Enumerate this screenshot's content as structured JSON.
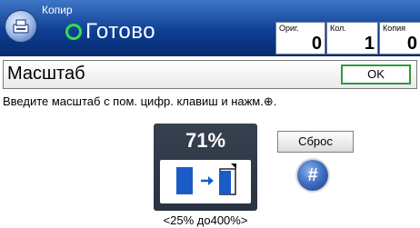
{
  "header": {
    "app_title": "Копир",
    "status": "Готово",
    "counters": [
      {
        "label": "Ориг.",
        "value": "0"
      },
      {
        "label": "Кол.",
        "value": "1"
      },
      {
        "label": "Копия",
        "value": "0"
      }
    ]
  },
  "dialog": {
    "title": "Масштаб",
    "ok_label": "OK",
    "instruction": "Введите масштаб с пом. цифр. клавиш и нажм.⊕.",
    "scale_value": "71%",
    "range": "<25% до400%>",
    "reset_label": "Сброс",
    "hash_label": "#"
  },
  "colors": {
    "header_top": "#3f76c6",
    "header_bottom": "#062a6e",
    "status_ready": "#32e04a",
    "ok_border": "#2e9b3a",
    "scale_panel": "#2f3846",
    "doc_blue": "#1a5bc8"
  },
  "icons": {
    "app": "copier-icon",
    "status": "ready-ring-icon",
    "scale": "reduce-document-icon",
    "hash": "hash-key-icon"
  }
}
